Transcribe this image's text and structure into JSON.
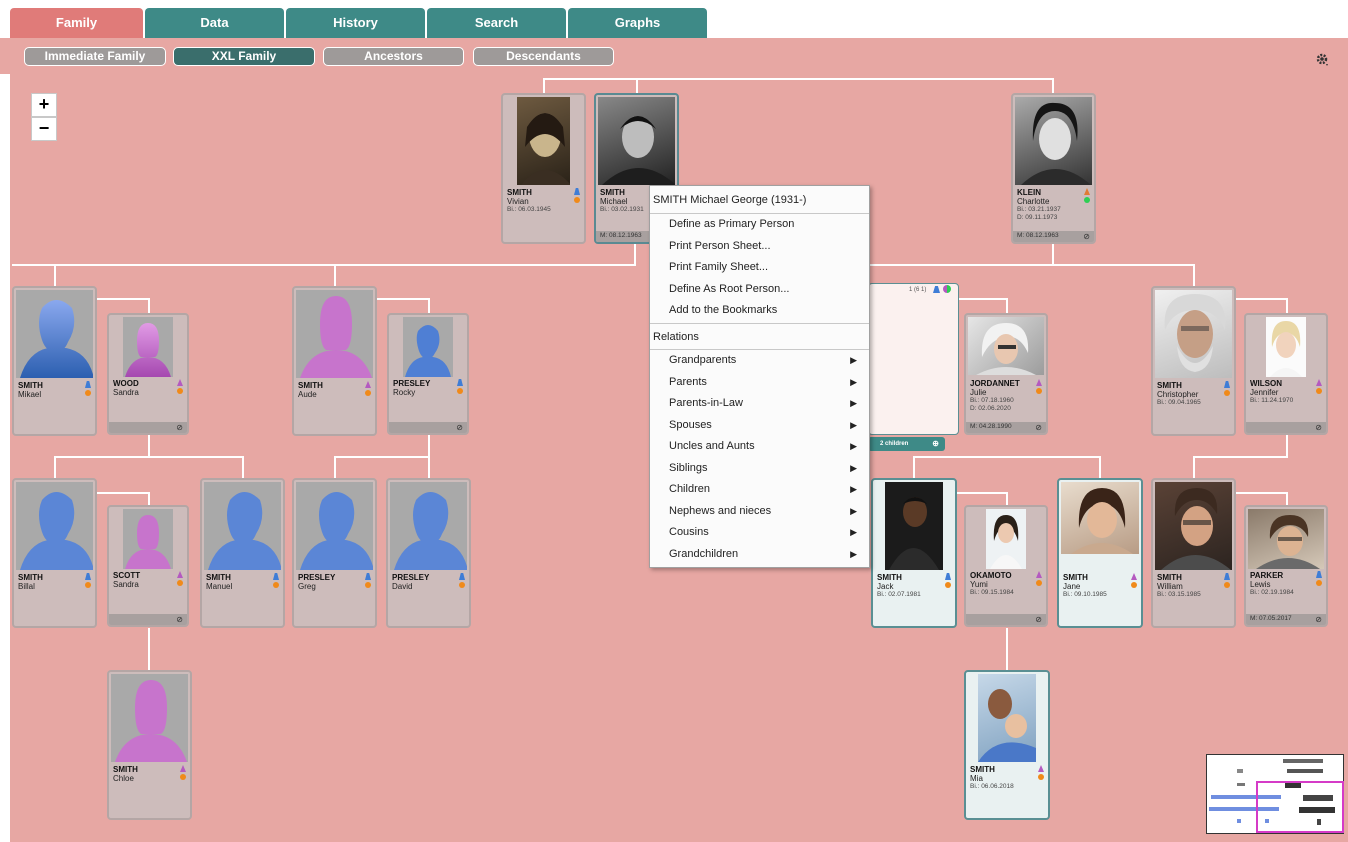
{
  "tabs": [
    {
      "label": "Family",
      "active": true
    },
    {
      "label": "Data",
      "active": false
    },
    {
      "label": "History",
      "active": false
    },
    {
      "label": "Search",
      "active": false
    },
    {
      "label": "Graphs",
      "active": false
    }
  ],
  "subtabs": [
    {
      "label": "Immediate Family",
      "active": false
    },
    {
      "label": "XXL Family",
      "active": true
    },
    {
      "label": "Ancestors",
      "active": false
    },
    {
      "label": "Descendants",
      "active": false
    }
  ],
  "toolbar": {
    "settings_icon": "gear-icon"
  },
  "zoom": {
    "in_label": "+",
    "out_label": "−"
  },
  "colors": {
    "male": "#3f7dd6",
    "female": "#b45ac0",
    "accent": "#3e8a87",
    "active_tab": "#e07b79",
    "canvas": "#e7a7a3"
  },
  "people": [
    {
      "surname": "SMITH",
      "first": "Vivian",
      "dates": "Bi.: 06.03.1945",
      "gender": "female"
    },
    {
      "surname": "SMITH",
      "first": "Michael",
      "dates": "Bi.: 03.02.1931",
      "marriage": "M: 08.12.1963",
      "gender": "male"
    },
    {
      "surname": "KLEIN",
      "first": "Charlotte",
      "dates": "Bi.: 03.21.1937",
      "dates2": "D: 09.11.1973",
      "marriage": "M: 08.12.1963",
      "gender": "female"
    },
    {
      "surname": "SMITH",
      "first": "Mikael",
      "gender": "male"
    },
    {
      "surname": "WOOD",
      "first": "Sandra",
      "gender": "female"
    },
    {
      "surname": "SMITH",
      "first": "Aude",
      "gender": "female"
    },
    {
      "surname": "PRESLEY",
      "first": "Rocky",
      "gender": "male"
    },
    {
      "surname": "JORDANNET",
      "first": "Julie",
      "dates": "Bi.: 07.18.1960",
      "dates2": "D: 02.06.2020",
      "marriage": "M: 04.28.1990",
      "gender": "female"
    },
    {
      "surname": "SMITH",
      "first": "Christopher",
      "dates": "Bi.: 09.04.1965",
      "gender": "male"
    },
    {
      "surname": "WILSON",
      "first": "Jennifer",
      "dates": "Bi.: 11.24.1970",
      "gender": "female"
    },
    {
      "surname": "SMITH",
      "first": "Billal",
      "gender": "male"
    },
    {
      "surname": "SCOTT",
      "first": "Sandra",
      "gender": "female"
    },
    {
      "surname": "SMITH",
      "first": "Manuel",
      "gender": "male"
    },
    {
      "surname": "PRESLEY",
      "first": "Greg",
      "gender": "male"
    },
    {
      "surname": "PRESLEY",
      "first": "David",
      "gender": "male"
    },
    {
      "surname": "SMITH",
      "first": "Jack",
      "dates": "Bi.: 02.07.1981",
      "gender": "male"
    },
    {
      "surname": "OKAMOTO",
      "first": "Yumi",
      "dates": "Bi.: 09.15.1984",
      "gender": "female"
    },
    {
      "surname": "SMITH",
      "first": "Jane",
      "dates": "Bi.: 09.10.1985",
      "gender": "female"
    },
    {
      "surname": "SMITH",
      "first": "William",
      "dates": "Bi.: 03.15.1985",
      "gender": "male"
    },
    {
      "surname": "PARKER",
      "first": "Lewis",
      "dates": "Bi.: 02.19.1984",
      "marriage": "M: 07.05.2017",
      "gender": "male"
    },
    {
      "surname": "SMITH",
      "first": "Chloe",
      "gender": "female"
    },
    {
      "surname": "SMITH",
      "first": "Mia",
      "dates": "Bi.: 06.06.2018",
      "gender": "female"
    }
  ],
  "family_box": {
    "count": "1 (6 1)",
    "children": "2 children"
  },
  "context_menu": {
    "title": "SMITH Michael George (1931-)",
    "items": [
      "Define as Primary Person",
      "Print Person Sheet...",
      "Print Family Sheet...",
      "Define As Root Person...",
      "Add to the Bookmarks"
    ],
    "relations_header": "Relations",
    "relations": [
      "Grandparents",
      "Parents",
      "Parents-in-Law",
      "Spouses",
      "Uncles and Aunts",
      "Siblings",
      "Children",
      "Nephews and nieces",
      "Cousins",
      "Grandchildren"
    ]
  }
}
